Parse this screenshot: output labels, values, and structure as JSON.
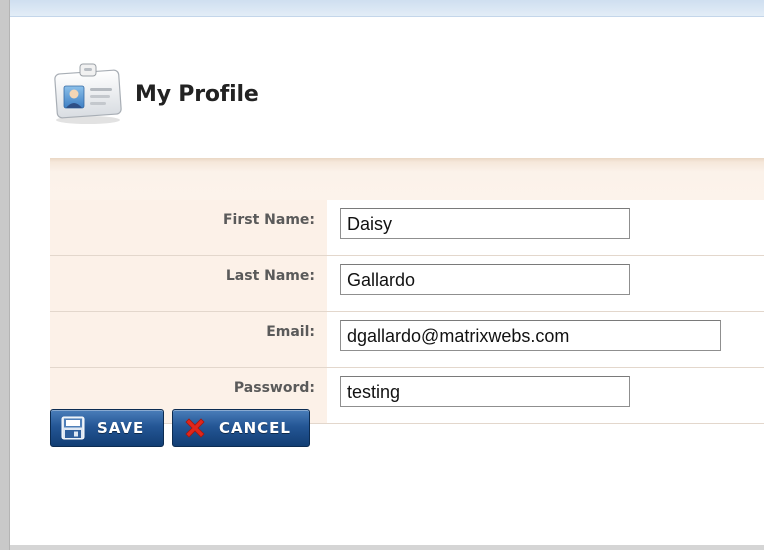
{
  "page": {
    "title": "My Profile",
    "icon": "profile-card-icon"
  },
  "form": {
    "fields": [
      {
        "label": "First Name:",
        "value": "Daisy"
      },
      {
        "label": "Last Name:",
        "value": "Gallardo"
      },
      {
        "label": "Email:",
        "value": "dgallardo@matrixwebs.com"
      },
      {
        "label": "Password:",
        "value": "testing"
      }
    ]
  },
  "actions": {
    "save": {
      "label": "SAVE",
      "icon": "floppy-disk-icon"
    },
    "cancel": {
      "label": "CANCEL",
      "icon": "red-x-icon"
    }
  },
  "colors": {
    "button_blue": "#245695",
    "label_panel": "#fcf1e8",
    "cancel_x": "#e0261b"
  }
}
